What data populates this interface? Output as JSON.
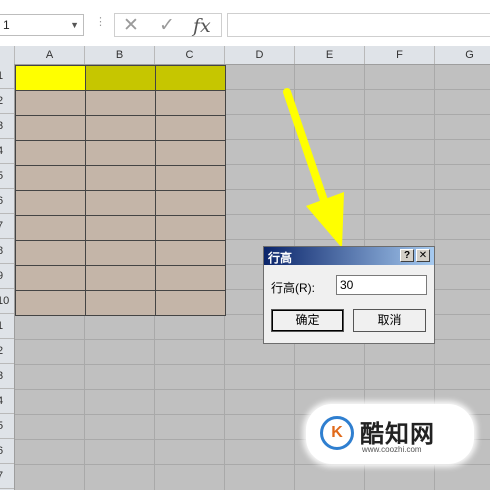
{
  "formula_bar": {
    "name_box_value": "1",
    "dots": "⋮",
    "cancel_icon": "✕",
    "enter_icon": "✓",
    "fx_label": "fx",
    "formula_value": ""
  },
  "columns": [
    "A",
    "B",
    "C",
    "D",
    "E",
    "F",
    "G"
  ],
  "rows": [
    "1",
    "2",
    "3",
    "4",
    "5",
    "6",
    "7",
    "8",
    "9",
    "10",
    "1",
    "2",
    "3",
    "4",
    "5",
    "6",
    "7"
  ],
  "cell_colors": {
    "header_a": "#ffff00",
    "header_bc": "#c6c600",
    "body": "#c4b5a8",
    "sheet_bg": "#c0c0c0"
  },
  "dialog": {
    "title": "行高",
    "help_button": "?",
    "close_button": "✕",
    "field_label": "行高(R):",
    "field_value": "30",
    "ok_label": "确定",
    "cancel_label": "取消"
  },
  "annotation": {
    "arrow_color": "#ffff00",
    "description_icon": "arrow-pointer-icon"
  },
  "watermark": {
    "brand": "酷知网",
    "logo_text": "K",
    "url": "www.coozhi.com"
  }
}
